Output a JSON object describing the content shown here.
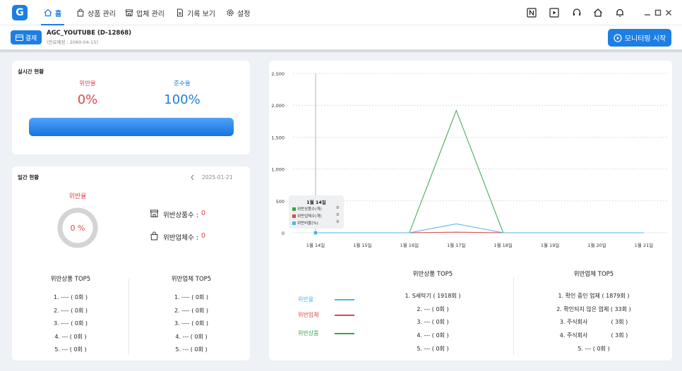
{
  "app": {
    "logo_text": "G",
    "nav": [
      {
        "label": "홈",
        "icon": "home-icon",
        "active": true
      },
      {
        "label": "상품 관리",
        "icon": "bag-icon",
        "active": false
      },
      {
        "label": "업체 관리",
        "icon": "store-icon",
        "active": false
      },
      {
        "label": "기록 보기",
        "icon": "document-icon",
        "active": false
      },
      {
        "label": "설정",
        "icon": "gear-icon",
        "active": false
      }
    ]
  },
  "subbar": {
    "pay_label": "결제",
    "account_name": "AGC_YOUTUBE (D-12868)",
    "expiry": "(만료예정 : 2060-04-15)",
    "monitor_label": "모니터링 시작"
  },
  "realtime": {
    "title": "실시간 현황",
    "violation_label": "위반율",
    "violation_value": "0%",
    "compliance_label": "준수율",
    "compliance_value": "100%",
    "compliance_fraction": 1.0
  },
  "daily": {
    "title": "일간 현황",
    "prev_icon": "chevron-left-icon",
    "date": "2025-01-21",
    "rate_label": "위반율",
    "rate_value": "0 %",
    "product_count_label": "위반상품수 :",
    "product_count_value": "0",
    "vendor_count_label": "위반업체수 :",
    "vendor_count_value": "0",
    "top_products_title": "위반상품 TOP5",
    "top_products": [
      "1. ---- ( 0회 )",
      "2. ---- ( 0회 )",
      "3. ---- ( 0회 )",
      "4. --- ( 0회 )",
      "5. --- ( 0회 )"
    ],
    "top_vendors_title": "위반업체 TOP5",
    "top_vendors": [
      "1. ---- ( 0회 )",
      "2. ---- ( 0회 )",
      "3. ---- ( 0회 )",
      "4. --- ( 0회 )",
      "5. --- ( 0회 )"
    ]
  },
  "chart_data": {
    "type": "line",
    "categories": [
      "1월 14일",
      "1월 15일",
      "1월 16일",
      "1월 17일",
      "1월 18일",
      "1월 19일",
      "1월 20일",
      "1월 21일"
    ],
    "y_ticks": [
      "2,500",
      "2,000",
      "1,500",
      "1,000",
      "500",
      "0"
    ],
    "ylim": [
      0,
      2500
    ],
    "grid": true,
    "series": [
      {
        "name": "위반상품",
        "color": "#3aa34a",
        "values": [
          0,
          0,
          0,
          1918,
          0,
          0,
          0,
          0
        ]
      },
      {
        "name": "위반업체",
        "color": "#e04646",
        "values": [
          0,
          0,
          0,
          10,
          0,
          0,
          0,
          0
        ]
      },
      {
        "name": "위반율",
        "color": "#4db5e8",
        "values": [
          0,
          0,
          0,
          140,
          0,
          0,
          0,
          0
        ]
      }
    ],
    "tooltip": {
      "title": "1월 14일",
      "rows": [
        {
          "label": "위반상품수(개)",
          "value": "0",
          "color": "#3aa34a"
        },
        {
          "label": "위반업체수(개)",
          "value": "0",
          "color": "#e04646"
        },
        {
          "label": "위반비율(%)",
          "value": "0",
          "color": "#4db5e8"
        }
      ]
    }
  },
  "legend": [
    {
      "label": "위반율",
      "color": "#4db5e8"
    },
    {
      "label": "위반업체",
      "color": "#e04646"
    },
    {
      "label": "위반상품",
      "color": "#3aa34a"
    }
  ],
  "summary": {
    "top_products_title": "위반상품 TOP5",
    "top_products": [
      "1. S세탁기 ( 1918회 )",
      "2. --- ( 0회 )",
      "3. --- ( 0회 )",
      "4. --- ( 0회 )",
      "5. --- ( 0회 )"
    ],
    "top_vendors_title": "위반업체 TOP5",
    "top_vendors": [
      "1. 확인 중인 업체 ( 1879회 )",
      "2. 확인되지 않은 업체 ( 33회 )",
      "3. 주식회사             ( 3회 )",
      "4. 주식회사             ( 3회 )",
      "5. --- ( 0회 )"
    ]
  }
}
